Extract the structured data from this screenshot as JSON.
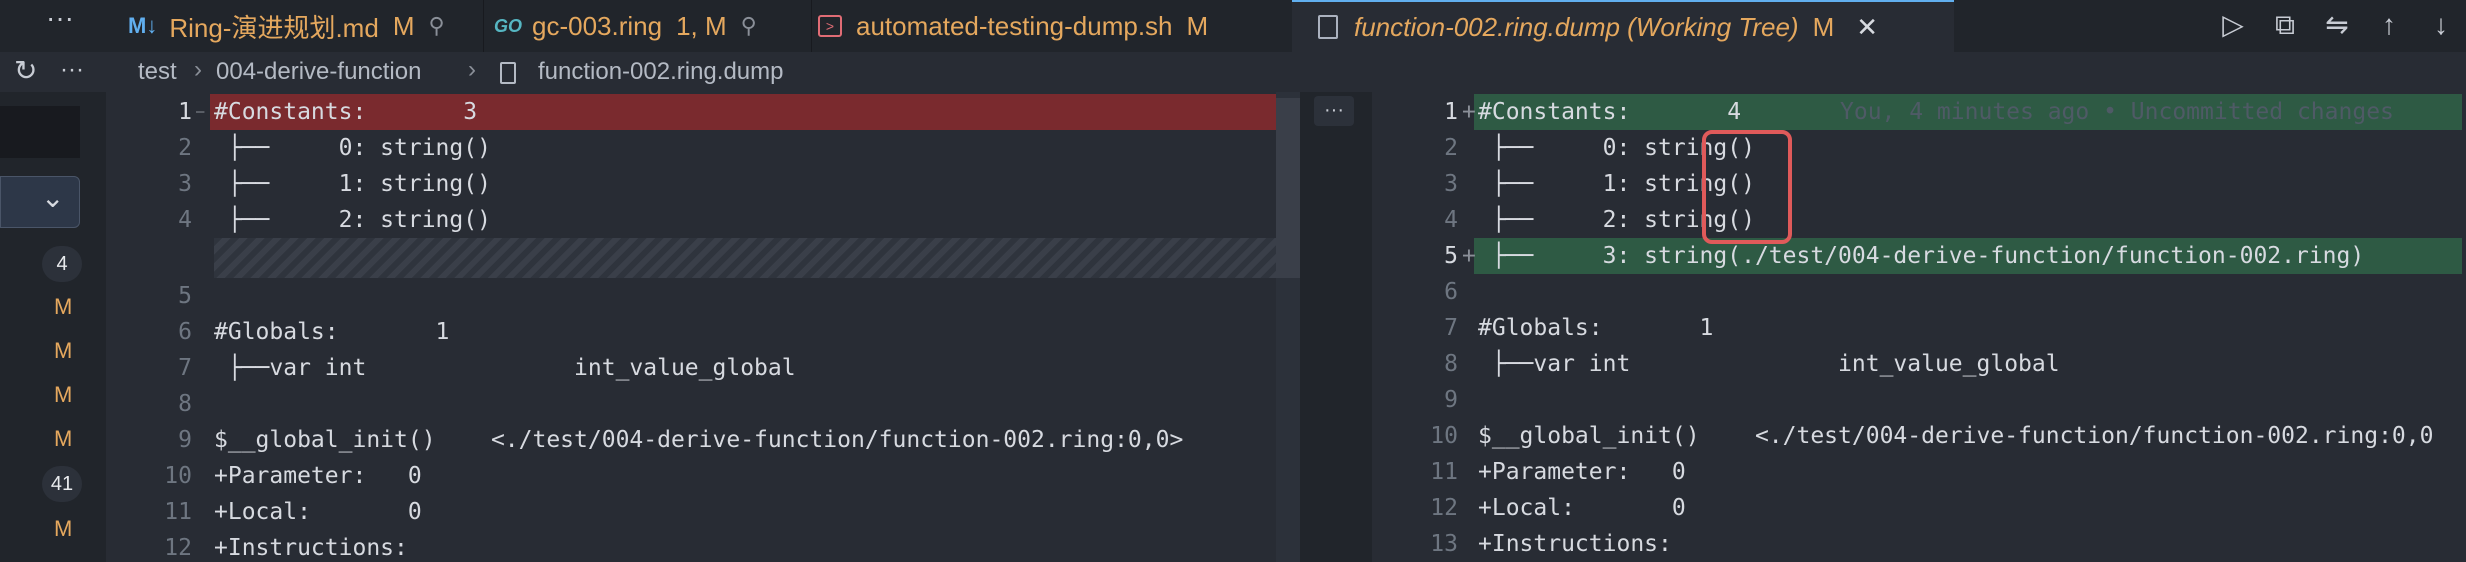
{
  "tabs": [
    {
      "icon": "M↓",
      "label": "Ring-演进规划.md",
      "status": "M",
      "pinned": true
    },
    {
      "icon": "GO",
      "label": "gc-003.ring",
      "status": "1, M",
      "pinned": true
    },
    {
      "icon": "sh",
      "label": "automated-testing-dump.sh",
      "status": "M",
      "pinned": false
    },
    {
      "icon": "file",
      "label": "function-002.ring.dump (Working Tree)",
      "status": "M",
      "active": true
    }
  ],
  "toolbar": {
    "more": "···",
    "icons": [
      "run-icon",
      "open-file-icon",
      "compare-icon",
      "arrow-up-icon",
      "arrow-down-icon"
    ]
  },
  "breadcrumb": [
    "test",
    "004-derive-function",
    "function-002.ring.dump"
  ],
  "activity": {
    "badges": [
      "4",
      "M",
      "M",
      "M",
      "M",
      "41",
      "M"
    ]
  },
  "left_editor": {
    "lines": [
      {
        "n": "1",
        "text": "#Constants:       3",
        "kind": "removed"
      },
      {
        "n": "2",
        "text": " ├──     0: string()",
        "kind": "normal"
      },
      {
        "n": "3",
        "text": " ├──     1: string()",
        "kind": "normal"
      },
      {
        "n": "4",
        "text": " ├──     2: string()",
        "kind": "normal"
      },
      {
        "n": "",
        "text": "",
        "kind": "filler"
      },
      {
        "n": "5",
        "text": "",
        "kind": "normal"
      },
      {
        "n": "6",
        "text": "#Globals:       1",
        "kind": "normal"
      },
      {
        "n": "7",
        "text": " ├──var int               int_value_global",
        "kind": "normal"
      },
      {
        "n": "8",
        "text": "",
        "kind": "normal"
      },
      {
        "n": "9",
        "text": "$__global_init()    <./test/004-derive-function/function-002.ring:0,0>",
        "kind": "normal"
      },
      {
        "n": "10",
        "text": "+Parameter:   0",
        "kind": "normal"
      },
      {
        "n": "11",
        "text": "+Local:       0",
        "kind": "normal"
      },
      {
        "n": "12",
        "text": "+Instructions:",
        "kind": "normal"
      }
    ]
  },
  "right_editor": {
    "lines": [
      {
        "n": "1",
        "text": "#Constants:       4",
        "kind": "added",
        "blame": "You, 4 minutes ago • Uncommitted changes"
      },
      {
        "n": "2",
        "text": " ├──     0: string()",
        "kind": "normal"
      },
      {
        "n": "3",
        "text": " ├──     1: string()",
        "kind": "normal"
      },
      {
        "n": "4",
        "text": " ├──     2: string()",
        "kind": "normal"
      },
      {
        "n": "5",
        "text": " ├──     3: string(./test/004-derive-function/function-002.ring)",
        "kind": "added"
      },
      {
        "n": "6",
        "text": "",
        "kind": "normal"
      },
      {
        "n": "7",
        "text": "#Globals:       1",
        "kind": "normal"
      },
      {
        "n": "8",
        "text": " ├──var int               int_value_global",
        "kind": "normal"
      },
      {
        "n": "9",
        "text": "",
        "kind": "normal"
      },
      {
        "n": "10",
        "text": "$__global_init()    <./test/004-derive-function/function-002.ring:0,0",
        "kind": "normal"
      },
      {
        "n": "11",
        "text": "+Parameter:   0",
        "kind": "normal"
      },
      {
        "n": "12",
        "text": "+Local:       0",
        "kind": "normal"
      },
      {
        "n": "13",
        "text": "+Instructions:",
        "kind": "normal"
      }
    ]
  },
  "center_more": "···",
  "colors": {
    "removed_bg": "#7a2a2e",
    "added_bg": "#2e5a44",
    "annotation_box": "#e05a5a",
    "modified_text": "#e5a85e"
  }
}
